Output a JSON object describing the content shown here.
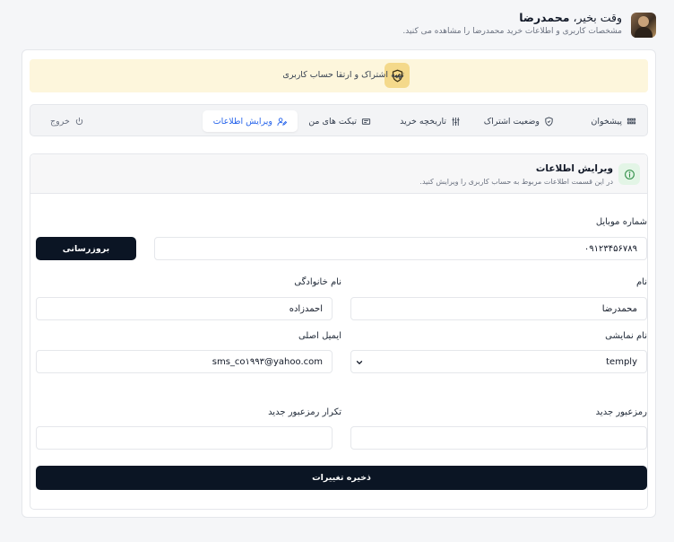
{
  "header": {
    "greeting_prefix": "وقت بخیر، ",
    "user_name": "محمدرضا",
    "subtitle": "مشخصات کاربری و اطلاعات خرید محمدرضا را مشاهده می کنید."
  },
  "notice": {
    "text": "تهیه اشتراک و ارتقا حساب کاربری",
    "icon": "shield-check-icon"
  },
  "tabs": [
    {
      "label": "پیشخوان",
      "icon": "dashboard-icon"
    },
    {
      "label": "وضعیت اشتراک",
      "icon": "shield-icon"
    },
    {
      "label": "تاریخچه خرید",
      "icon": "history-icon"
    },
    {
      "label": "تیکت های من",
      "icon": "ticket-icon"
    },
    {
      "label": "ویرایش اطلاعات",
      "icon": "user-edit-icon",
      "active": true
    },
    {
      "label": "خروج",
      "icon": "power-icon"
    }
  ],
  "panel": {
    "title": "ویرایش اطلاعات",
    "subtitle": "در این قسمت اطلاعات مربوط به حساب کاربری را ویرایش کنید.",
    "icon": "info-icon"
  },
  "form": {
    "mobile_label": "شماره موبایل",
    "mobile_value": "۰۹۱۲۳۴۵۶۷۸۹",
    "update_button": "بروزرسانی",
    "first_name_label": "نام",
    "first_name_value": "محمدرضا",
    "last_name_label": "نام خانوادگی",
    "last_name_value": "احمدزاده",
    "display_name_label": "نام نمایشی",
    "display_name_value": "temply",
    "email_label": "ایمیل اصلی",
    "email_value": "sms_co۱۹۹۳@yahoo.com",
    "new_password_label": "رمزعبور جدید",
    "new_password_value": "",
    "confirm_password_label": "تکرار رمزعبور جدید",
    "confirm_password_value": "",
    "save_button": "ذخیره تغییرات"
  },
  "colors": {
    "primary_dark": "#0b1524",
    "notice_bg": "#fdf6dc",
    "notice_icon_bg": "#f4d98b",
    "active_tab": "#2563eb",
    "panel_icon_bg": "#e3f5e6"
  }
}
